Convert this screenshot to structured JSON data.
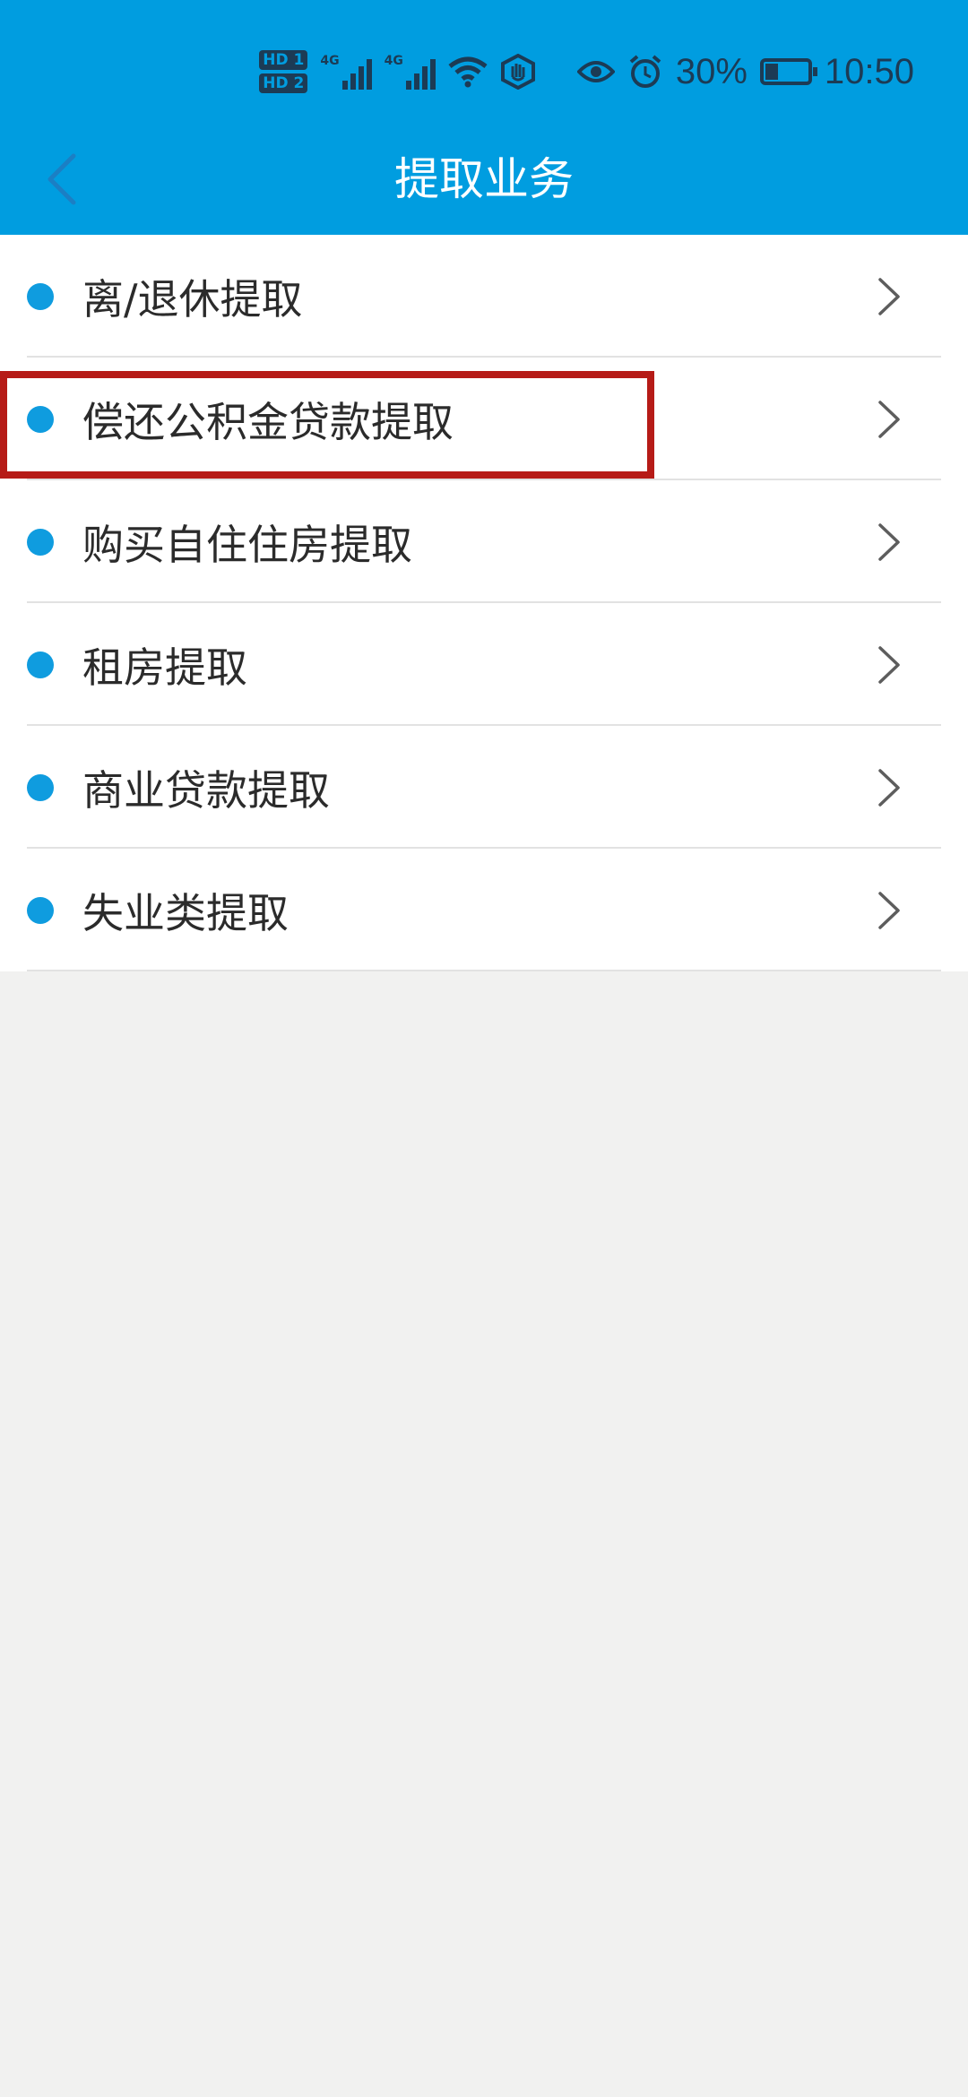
{
  "status_bar": {
    "hd1": "HD 1",
    "hd2": "HD 2",
    "network1": "4G",
    "network2": "4G",
    "battery_percent_text": "30%",
    "battery_level": 0.3,
    "time": "10:50",
    "icons": [
      "hd-badge-icon",
      "signal-icon",
      "signal-icon",
      "wifi-icon",
      "hand-icon",
      "eye-icon",
      "alarm-icon",
      "battery-icon"
    ]
  },
  "header": {
    "title": "提取业务",
    "back_icon": "chevron-left-icon"
  },
  "colors": {
    "header_bg": "#009de0",
    "dot": "#0f9cdf",
    "highlight": "#b61b17",
    "page_bg": "#f1f1f0"
  },
  "list": {
    "items": [
      {
        "label": "离/退休提取"
      },
      {
        "label": "偿还公积金贷款提取",
        "highlighted": true
      },
      {
        "label": "购买自住住房提取"
      },
      {
        "label": "租房提取"
      },
      {
        "label": "商业贷款提取"
      },
      {
        "label": "失业类提取"
      }
    ],
    "item_icon": "chevron-right-icon"
  }
}
